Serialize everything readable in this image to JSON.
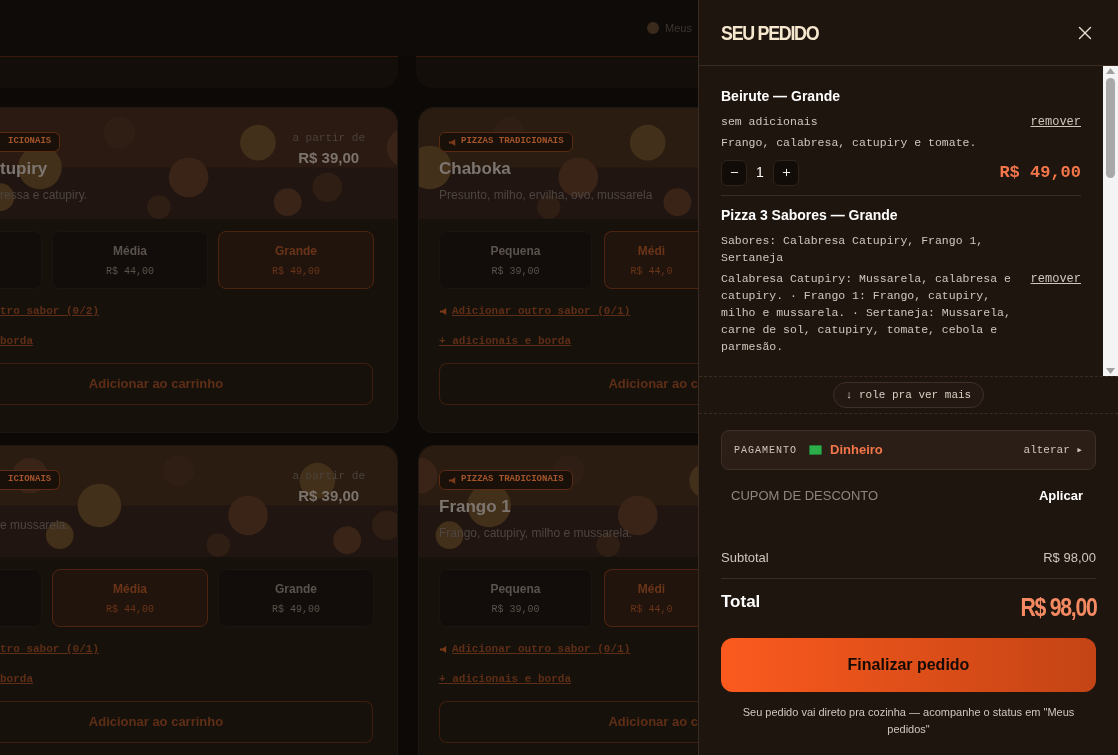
{
  "background": {
    "header": {
      "link": "Meus"
    },
    "cards": [
      {
        "kind": "left",
        "badge": "ICIONAIS",
        "title": "tupiry",
        "description": "ressa e catupiry.",
        "from_label": "a partir de",
        "from_price": "R$ 39,00",
        "sizes": [
          {
            "label": "Média",
            "price": "R$ 44,00",
            "selected": false
          },
          {
            "label": "Grande",
            "price": "R$ 49,00",
            "selected": true
          }
        ],
        "add_flavor": "tro sabor (0/2)",
        "extras": "borda",
        "add_button": "Adicionar ao carrinho"
      },
      {
        "kind": "right",
        "badge": "PIZZAS TRADICIONAIS",
        "title": "Chaboka",
        "description": "Presunto, milho, ervilha, ovo, mussarela",
        "sizes": [
          {
            "label": "Pequena",
            "price": "R$ 39,00",
            "selected": false
          },
          {
            "label": "Médi",
            "price": "R$ 44,0",
            "selected": true
          }
        ],
        "add_flavor": "Adicionar outro sabor (0/1)",
        "extras": "+ adicionais e borda",
        "add_button": "Adicionar ao c"
      },
      {
        "kind": "left",
        "badge": "ICIONAIS",
        "description": "e mussarela.",
        "from_label": "a partir de",
        "from_price": "R$ 39,00",
        "sizes": [
          {
            "label": "Média",
            "price": "R$ 44,00",
            "selected": true
          },
          {
            "label": "Grande",
            "price": "R$ 49,00",
            "selected": false
          }
        ],
        "add_flavor": "tro sabor (0/1)",
        "extras": "borda",
        "add_button": "Adicionar ao carrinho"
      },
      {
        "kind": "right",
        "badge": "PIZZAS TRADICIONAIS",
        "title": "Frango 1",
        "description": "Frango, catupiry, milho e mussarela.",
        "sizes": [
          {
            "label": "Pequena",
            "price": "R$ 39,00",
            "selected": false
          },
          {
            "label": "Médi",
            "price": "R$ 44,0",
            "selected": true
          }
        ],
        "add_flavor": "Adicionar outro sabor (0/1)",
        "extras": "+ adicionais e borda",
        "add_button": "Adicionar ao c"
      }
    ]
  },
  "cart": {
    "title": "SEU PEDIDO",
    "items": [
      {
        "name": "Beirute — Grande",
        "extras": "sem adicionais",
        "description": "Frango, calabresa, catupiry e tomate.",
        "remove": "remover",
        "quantity": "1",
        "price": "R$ 49,00"
      },
      {
        "name": "Pizza 3 Sabores — Grande",
        "flavors": "Sabores: Calabresa Catupiry, Frango 1, Sertaneja",
        "description": "Calabresa Catupiry: Mussarela, calabresa e catupiry. · Frango 1: Frango, catupiry, milho e mussarela. · Sertaneja: Mussarela, carne de sol, catupiry, tomate, cebola e parmesão.",
        "remove": "remover"
      }
    ],
    "scroll_hint": "↓ role pra ver mais",
    "payment": {
      "label": "PAGAMENTO",
      "method": "Dinheiro",
      "change": "alterar ▸"
    },
    "coupon": {
      "placeholder": "CUPOM DE DESCONTO",
      "apply": "Aplicar"
    },
    "subtotal": {
      "label": "Subtotal",
      "value": "R$ 98,00"
    },
    "total": {
      "label": "Total",
      "value": "R$ 98,00"
    },
    "checkout": "Finalizar pedido",
    "note": "Seu pedido vai direto pra cozinha — acompanhe o status em \"Meus pedidos\""
  }
}
